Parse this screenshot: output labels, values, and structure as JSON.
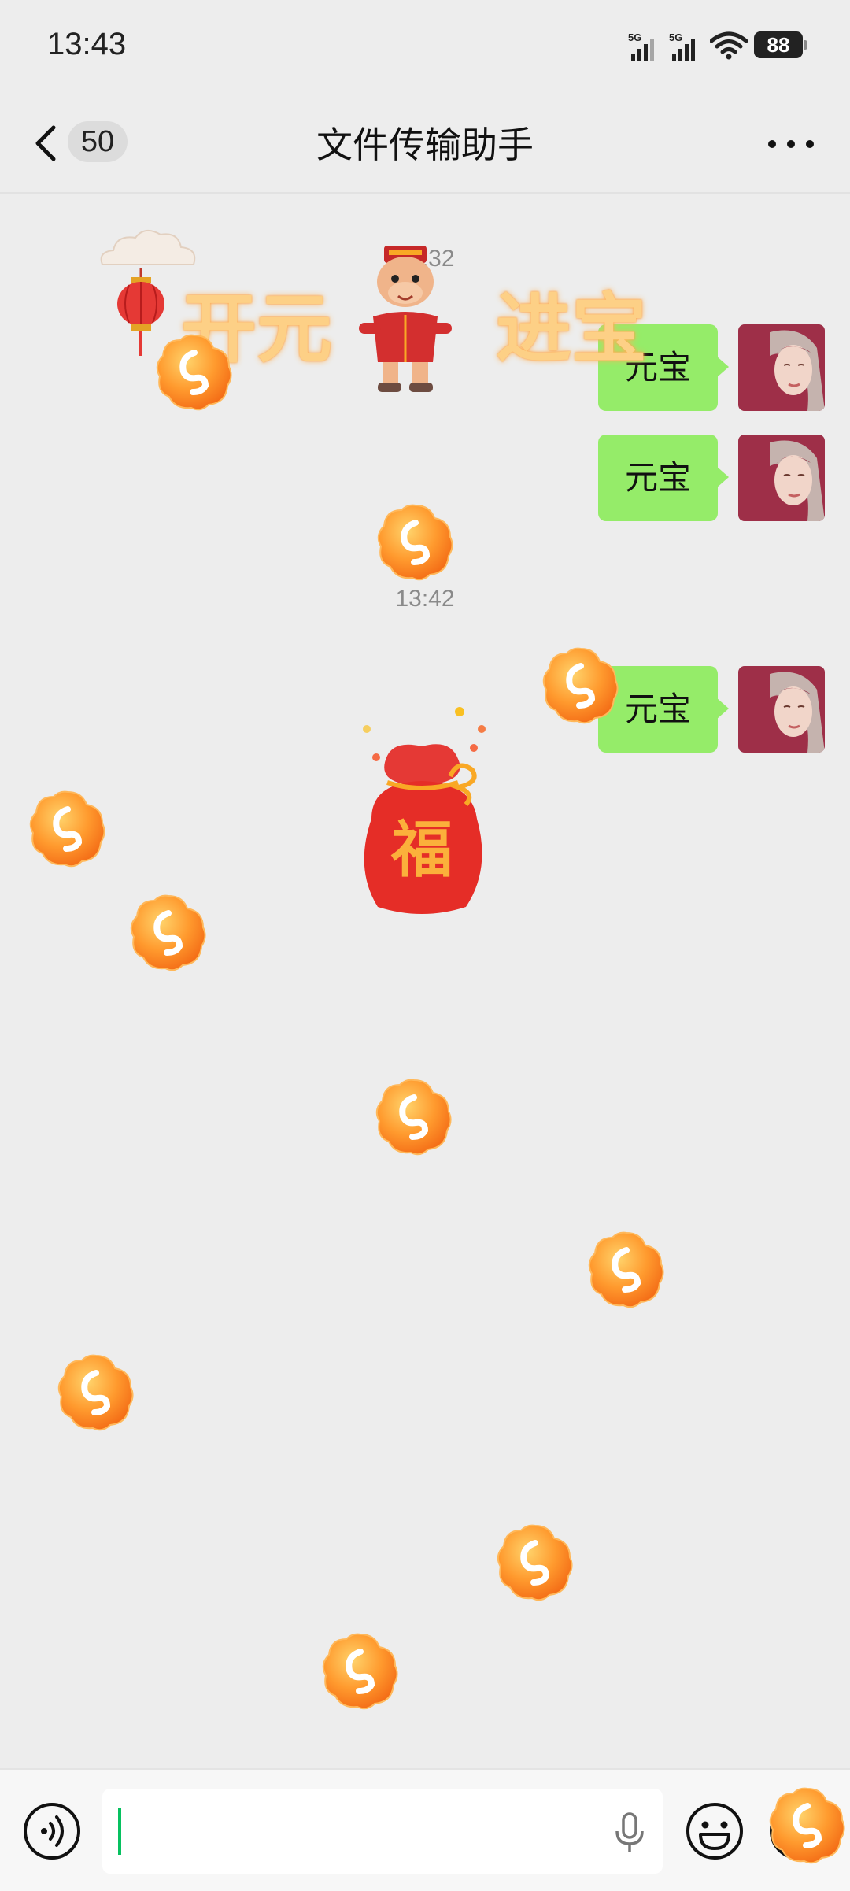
{
  "status_bar": {
    "time": "13:43",
    "network_1": "5G",
    "network_2": "5G",
    "battery": "88"
  },
  "nav": {
    "unread_count": "50",
    "title": "文件传输助手"
  },
  "chat": {
    "timestamp_1": "13:32",
    "timestamp_2": "13:42",
    "messages": [
      {
        "text": "元宝"
      },
      {
        "text": "元宝"
      },
      {
        "text": "元宝"
      }
    ]
  },
  "sticker": {
    "banner_left": "开元",
    "banner_right": "进宝",
    "bag_char": "福"
  },
  "colors": {
    "bubble": "#95ec69",
    "accent": "#07c160",
    "background": "#ededed"
  }
}
